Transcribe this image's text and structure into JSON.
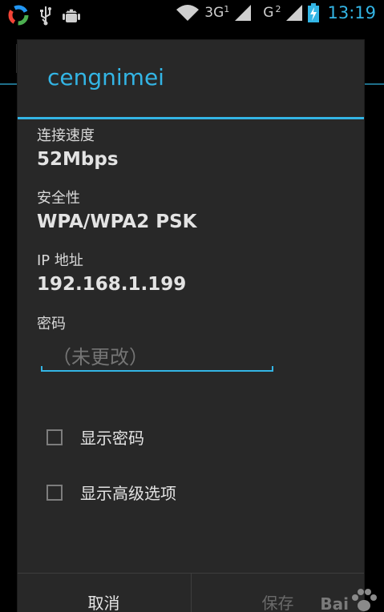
{
  "status_bar": {
    "network_3g": "3G",
    "sim1": "1",
    "network_g": "G",
    "sim2": "2",
    "time": "13:19"
  },
  "dialog": {
    "title": "cengnimei",
    "fields": [
      {
        "label": "连接速度",
        "value": "52Mbps"
      },
      {
        "label": "安全性",
        "value": "WPA/WPA2 PSK"
      },
      {
        "label": "IP 地址",
        "value": "192.168.1.199"
      }
    ],
    "password": {
      "label": "密码",
      "placeholder": "（未更改）"
    },
    "checkboxes": [
      {
        "label": "显示密码",
        "checked": false
      },
      {
        "label": "显示高级选项",
        "checked": false
      }
    ],
    "buttons": {
      "cancel": "取消",
      "save": "保存"
    }
  },
  "watermark": {
    "text": "Bai"
  },
  "colors": {
    "accent": "#33b5e5",
    "dialog_bg": "#282828"
  }
}
